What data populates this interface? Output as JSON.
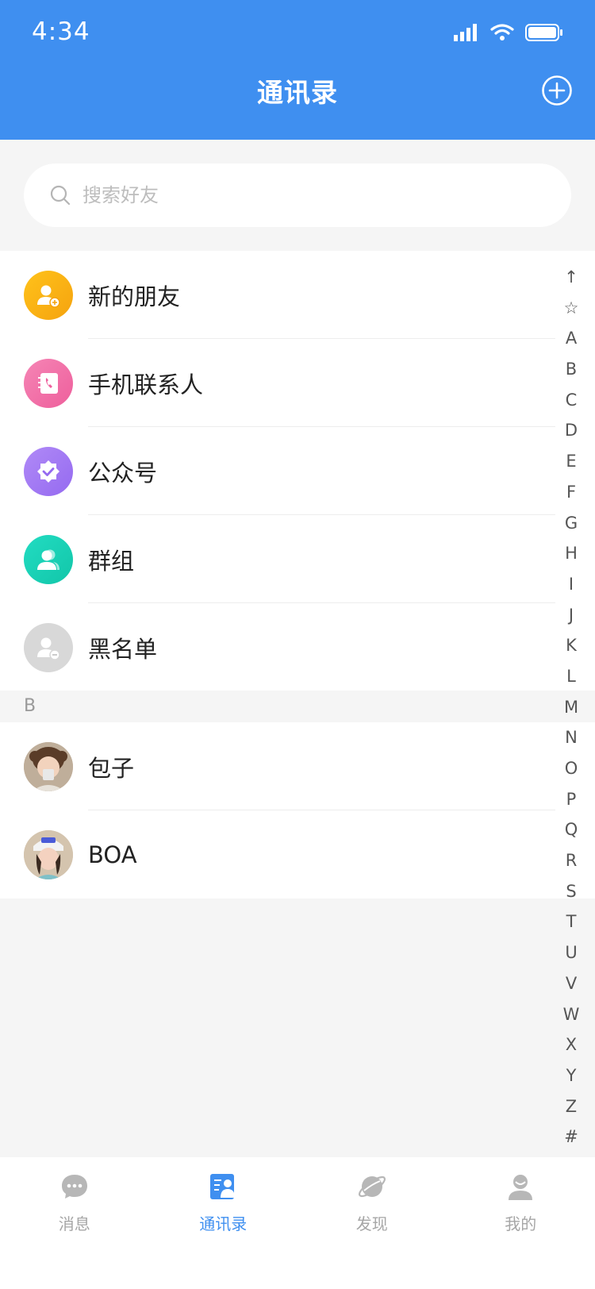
{
  "status_bar": {
    "time": "4:34"
  },
  "header": {
    "title": "通讯录"
  },
  "search": {
    "placeholder": "搜索好友"
  },
  "features": [
    {
      "label": "新的朋友",
      "icon": "add-friend-icon",
      "color": "#fbb117"
    },
    {
      "label": "手机联系人",
      "icon": "phone-book-icon",
      "color": "#f06aa2"
    },
    {
      "label": "公众号",
      "icon": "verified-badge-icon",
      "color": "#a277f2"
    },
    {
      "label": "群组",
      "icon": "group-icon",
      "color": "#19d0b6"
    },
    {
      "label": "黑名单",
      "icon": "blacklist-icon",
      "color": "#d7d7d7"
    }
  ],
  "section": {
    "letter": "B"
  },
  "contacts": [
    {
      "name": "包子"
    },
    {
      "name": "BOA"
    }
  ],
  "index": [
    "↑",
    "☆",
    "A",
    "B",
    "C",
    "D",
    "E",
    "F",
    "G",
    "H",
    "I",
    "J",
    "K",
    "L",
    "M",
    "N",
    "O",
    "P",
    "Q",
    "R",
    "S",
    "T",
    "U",
    "V",
    "W",
    "X",
    "Y",
    "Z",
    "#"
  ],
  "tabs": [
    {
      "label": "消息",
      "icon": "chat-bubble-icon",
      "active": false
    },
    {
      "label": "通讯录",
      "icon": "contacts-icon",
      "active": true
    },
    {
      "label": "发现",
      "icon": "planet-icon",
      "active": false
    },
    {
      "label": "我的",
      "icon": "profile-icon",
      "active": false
    }
  ],
  "colors": {
    "primary": "#3f8ff0"
  }
}
